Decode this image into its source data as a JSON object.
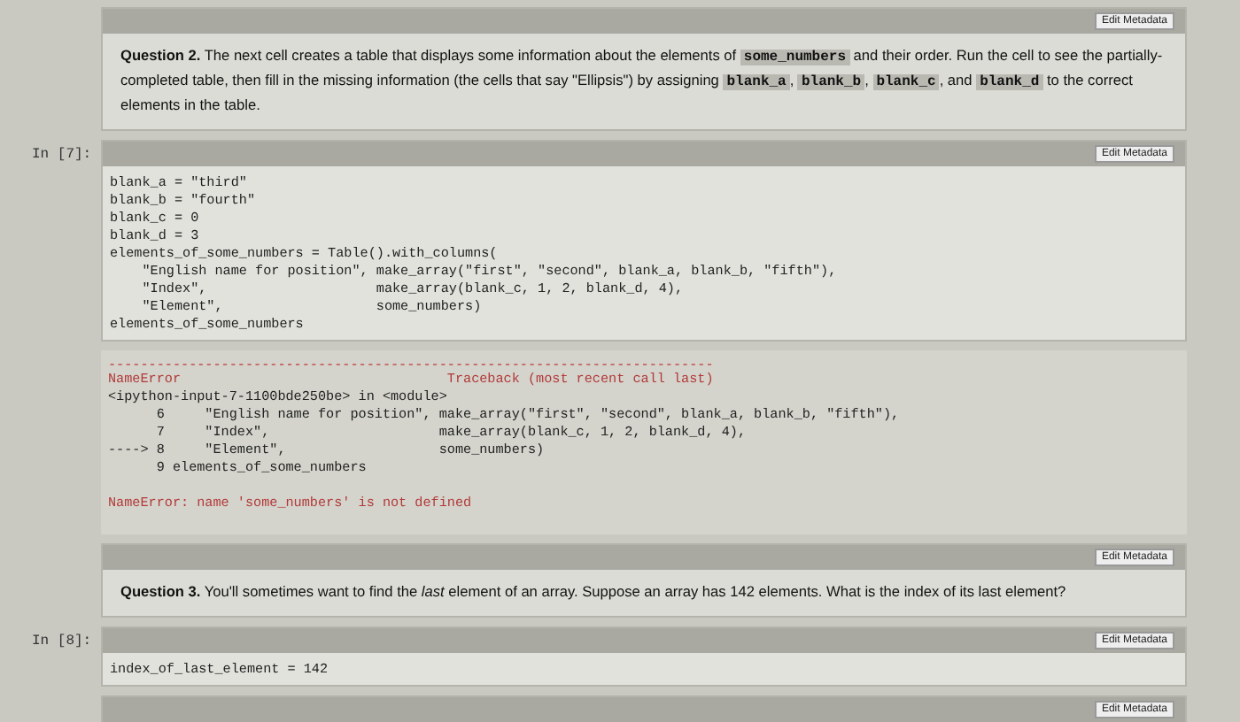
{
  "cells": [
    {
      "kind": "markdown",
      "button": "Edit Metadata",
      "parts": [
        {
          "kind": "bold",
          "text": "Question 2."
        },
        {
          "kind": "text",
          "text": " The next cell creates a table that displays some information about the elements of "
        },
        {
          "kind": "code",
          "text": "some_numbers"
        },
        {
          "kind": "text",
          "text": " and their order. Run the cell to see the partially-completed table, then fill in the missing information (the cells that say \"Ellipsis\") by assigning "
        },
        {
          "kind": "code",
          "text": "blank_a"
        },
        {
          "kind": "text",
          "text": ", "
        },
        {
          "kind": "code",
          "text": "blank_b"
        },
        {
          "kind": "text",
          "text": ", "
        },
        {
          "kind": "code",
          "text": "blank_c"
        },
        {
          "kind": "text",
          "text": ", and "
        },
        {
          "kind": "code",
          "text": "blank_d"
        },
        {
          "kind": "text",
          "text": " to the correct elements in the table."
        }
      ]
    },
    {
      "kind": "code",
      "prompt": "In [7]:",
      "button": "Edit Metadata",
      "lines": [
        "blank_a = \"third\"",
        "blank_b = \"fourth\"",
        "blank_c = 0",
        "blank_d = 3",
        "elements_of_some_numbers = Table().with_columns(",
        "    \"English name for position\", make_array(\"first\", \"second\", blank_a, blank_b, \"fifth\"),",
        "    \"Index\",                     make_array(blank_c, 1, 2, blank_d, 4),",
        "    \"Element\",                   some_numbers)",
        "elements_of_some_numbers"
      ]
    },
    {
      "kind": "error",
      "rule": "---------------------------------------------------------------------------",
      "lines": [
        "NameError                                 Traceback (most recent call last)",
        "<ipython-input-7-1100bde250be> in <module>",
        "      6     \"English name for position\", make_array(\"first\", \"second\", blank_a, blank_b, \"fifth\"),",
        "      7     \"Index\",                     make_array(blank_c, 1, 2, blank_d, 4),",
        "----> 8     \"Element\",                   some_numbers)",
        "      9 elements_of_some_numbers"
      ],
      "message": "NameError: name 'some_numbers' is not defined"
    },
    {
      "kind": "markdown",
      "button": "Edit Metadata",
      "parts": [
        {
          "kind": "bold",
          "text": "Question 3."
        },
        {
          "kind": "text",
          "text": " You'll sometimes want to find the "
        },
        {
          "kind": "italic",
          "text": "last"
        },
        {
          "kind": "text",
          "text": " element of an array. Suppose an array has 142 elements. What is the index of its last element?"
        }
      ]
    },
    {
      "kind": "code",
      "prompt": "In [8]:",
      "button": "Edit Metadata",
      "lines": [
        "index_of_last_element = 142"
      ]
    },
    {
      "kind": "code",
      "button": "Edit Metadata"
    }
  ]
}
